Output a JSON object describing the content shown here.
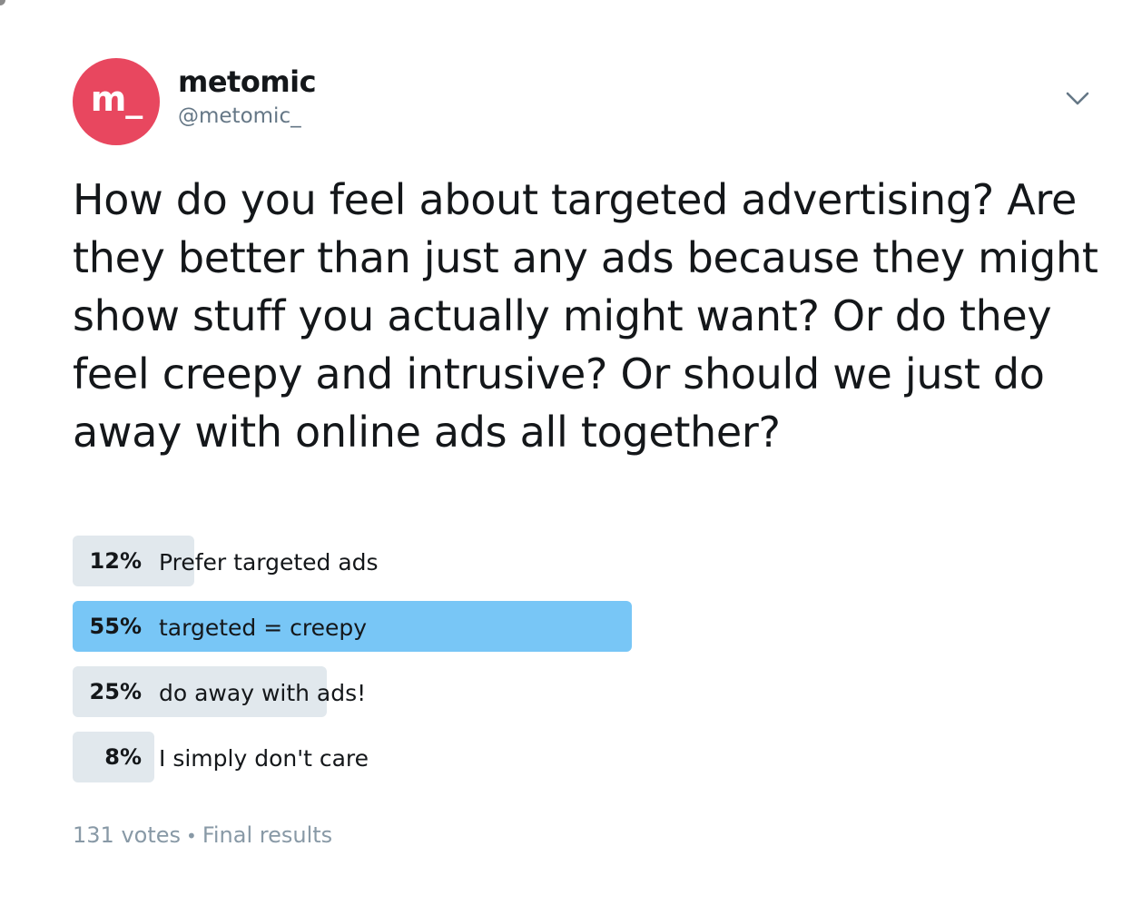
{
  "tweet": {
    "author": {
      "display_name": "metomic",
      "handle": "@metomic_",
      "avatar_text": "m_",
      "avatar_color": "#e8475f"
    },
    "menu_icon": "chevron-down-icon",
    "text": "How do you feel about targeted advertising? Are they better than just any ads because they might show stuff you actually might want? Or do they feel creepy and intrusive? Or should we just do away with online ads all together?"
  },
  "poll": {
    "options": [
      {
        "percent_label": "12%",
        "percent": 12,
        "label": "Prefer targeted ads",
        "winner": false
      },
      {
        "percent_label": "55%",
        "percent": 55,
        "label": "targeted = creepy",
        "winner": true
      },
      {
        "percent_label": "25%",
        "percent": 25,
        "label": "do away with ads!",
        "winner": false
      },
      {
        "percent_label": "8%",
        "percent": 8,
        "label": "I simply don't care",
        "winner": false
      }
    ],
    "votes": "131 votes",
    "separator": "•",
    "status": "Final results",
    "colors": {
      "winner": "#78c6f6",
      "other": "#e1e8ed"
    }
  }
}
